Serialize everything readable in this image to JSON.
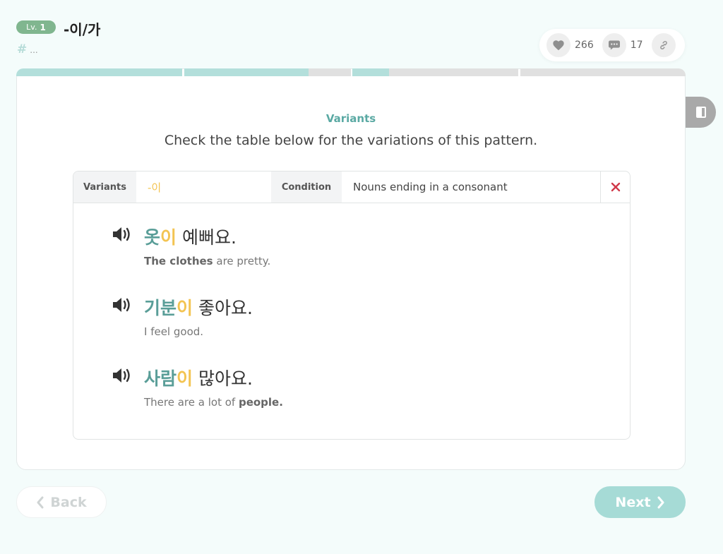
{
  "header": {
    "level_prefix": "Lv.",
    "level_number": "1",
    "pattern_title": "-이/가",
    "hash_symbol": "#",
    "hash_tags": "..."
  },
  "stats": {
    "likes_count": "266",
    "comments_count": "17"
  },
  "progress": {
    "segments": [
      {
        "fill": 1.0,
        "color": "#b3dfdb"
      },
      {
        "fill": 1.0,
        "color": "#b3dfdb"
      },
      {
        "fill": 0.0,
        "color": "#e0e0e0"
      },
      {
        "fill": 1.0,
        "color": "#b3dfdb"
      },
      {
        "fill": 0.0,
        "color": "#e0e0e0"
      },
      {
        "fill": 0.0,
        "color": "#e0e0e0"
      }
    ]
  },
  "section": {
    "label": "Variants",
    "description": "Check the table below for the variations of this pattern."
  },
  "variant_table": {
    "variants_label": "Variants",
    "variant_value": "-이",
    "condition_label": "Condition",
    "condition_value": "Nouns ending in a consonant",
    "examples": [
      {
        "noun": "옷",
        "particle": "이",
        "rest": " 예뻐요.",
        "en_bold": "The clothes",
        "en_rest": " are pretty."
      },
      {
        "noun": "기분",
        "particle": "이",
        "rest": " 좋아요.",
        "en_plain": "I feel good."
      },
      {
        "noun": "사람",
        "particle": "이",
        "rest": " 많아요.",
        "en_rest_before": "There are a lot of ",
        "en_bold": "people."
      }
    ]
  },
  "nav": {
    "back_label": "Back",
    "next_label": "Next"
  },
  "colors": {
    "accent_teal": "#5aa9a3",
    "highlight_yellow": "#f3c452",
    "level_badge_green": "#80b68f",
    "close_red": "#d0394a",
    "next_button": "#a6dbd6"
  },
  "icons": [
    "heart-icon",
    "comment-icon",
    "link-icon",
    "note-icon",
    "close-icon",
    "speaker-icon",
    "chevron-left-icon",
    "chevron-right-icon"
  ]
}
